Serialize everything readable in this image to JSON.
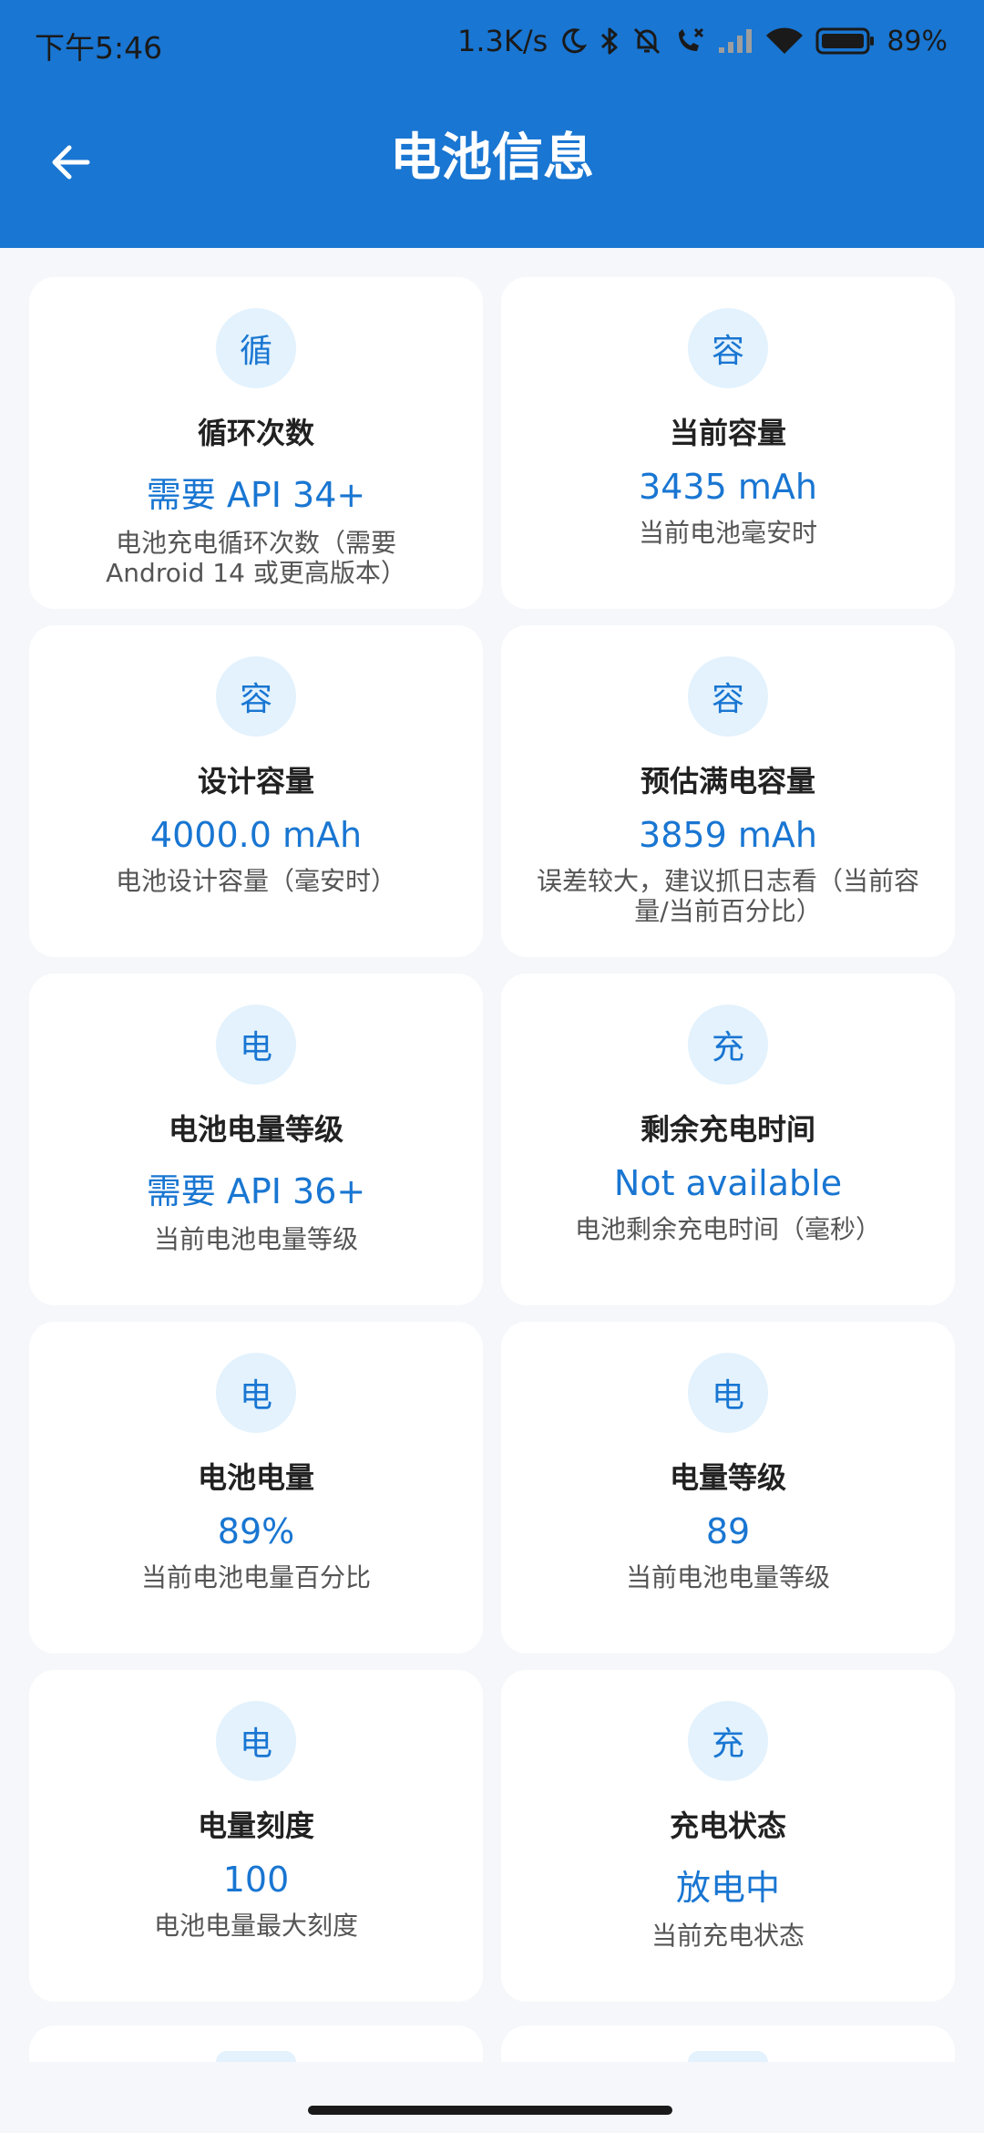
{
  "status_bar": {
    "time": "下午5:46",
    "network_speed": "1.3K/s",
    "battery_percent": "89%",
    "icons": [
      "moon-icon",
      "bluetooth-icon",
      "muted-bell-icon",
      "missed-call-icon",
      "signal-icon",
      "wifi-icon",
      "battery-icon"
    ]
  },
  "header": {
    "title": "电池信息",
    "back_icon": "arrow-left-icon",
    "color": "#1976d2"
  },
  "cards": [
    {
      "icon": "循",
      "title": "循环次数",
      "value": "需要 API 34+",
      "desc": "电池充电循环次数（需要 Android 14 或更高版本）"
    },
    {
      "icon": "容",
      "title": "当前容量",
      "value": "3435 mAh",
      "desc": "当前电池毫安时"
    },
    {
      "icon": "容",
      "title": "设计容量",
      "value": "4000.0 mAh",
      "desc": "电池设计容量（毫安时）"
    },
    {
      "icon": "容",
      "title": "预估满电容量",
      "value": "3859 mAh",
      "desc": "误差较大，建议抓日志看（当前容量/当前百分比）"
    },
    {
      "icon": "电",
      "title": "电池电量等级",
      "value": "需要 API 36+",
      "desc": "当前电池电量等级"
    },
    {
      "icon": "充",
      "title": "剩余充电时间",
      "value": "Not available",
      "desc": "电池剩余充电时间（毫秒）"
    },
    {
      "icon": "电",
      "title": "电池电量",
      "value": "89%",
      "desc": "当前电池电量百分比"
    },
    {
      "icon": "电",
      "title": "电量等级",
      "value": "89",
      "desc": "当前电池电量等级"
    },
    {
      "icon": "电",
      "title": "电量刻度",
      "value": "100",
      "desc": "电池电量最大刻度"
    },
    {
      "icon": "充",
      "title": "充电状态",
      "value": "放电中",
      "desc": "当前充电状态"
    }
  ]
}
